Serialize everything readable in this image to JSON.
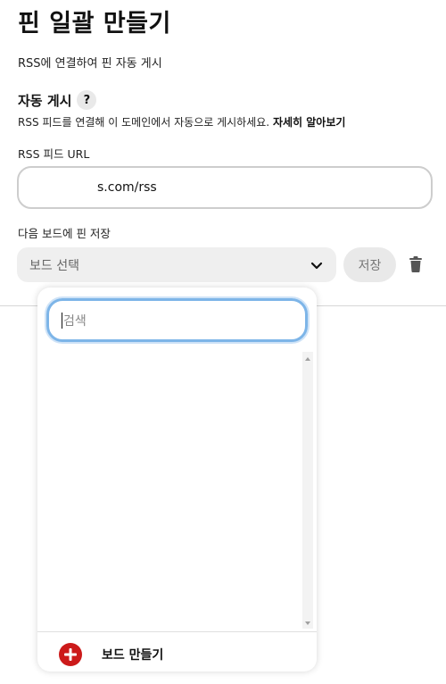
{
  "header": {
    "title": "핀 일괄 만들기",
    "subtitle": "RSS에 연결하여 핀 자동 게시"
  },
  "auto_post": {
    "title": "자동 게시",
    "help_label": "?",
    "description": "RSS 피드를 연결해 이 도메인에서 자동으로 게시하세요.",
    "learn_more": "자세히 알아보기"
  },
  "rss": {
    "label": "RSS 피드 URL",
    "value": "s.com/rss"
  },
  "board": {
    "label": "다음 보드에 핀 저장",
    "select_value": "보드 선택",
    "save_label": "저장"
  },
  "dropdown": {
    "search_placeholder": "검색",
    "create_label": "보드 만들기"
  },
  "colors": {
    "accent_red": "#cc1a1a",
    "focus_blue": "#7db5e8"
  }
}
